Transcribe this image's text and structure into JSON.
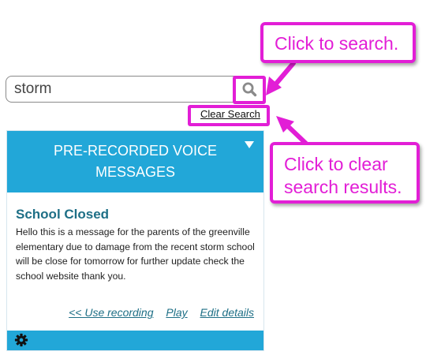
{
  "search": {
    "value": "storm",
    "clear_label": "Clear Search"
  },
  "callouts": {
    "search": "Click to search.",
    "clear_line1": "Click to clear",
    "clear_line2": "search results."
  },
  "card": {
    "title_line1": "PRE-RECORDED VOICE",
    "title_line2": "MESSAGES",
    "message_title": "School Closed",
    "message_body": "Hello this is a message for the parents of the greenville elementary due to damage from the recent storm school will be close for tomorrow for further update check the school website thank you.",
    "actions": {
      "use_recording": "<< Use recording",
      "play": "Play",
      "edit_details": "Edit details"
    }
  },
  "icons": {
    "search": "search-icon",
    "dropdown": "caret-down-icon",
    "settings": "gear-icon"
  },
  "colors": {
    "accent": "#22a7d8",
    "highlight": "#e21ed6",
    "title_text": "#1e6f86"
  }
}
